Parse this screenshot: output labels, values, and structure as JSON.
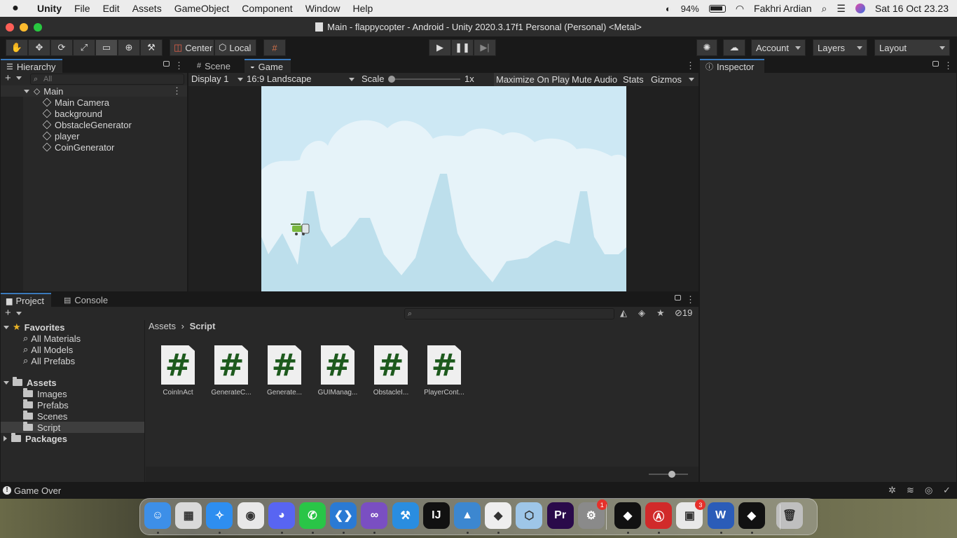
{
  "menubar": {
    "app": "Unity",
    "items": [
      "File",
      "Edit",
      "Assets",
      "GameObject",
      "Component",
      "Window",
      "Help"
    ],
    "battery": "94%",
    "user": "Fakhri Ardian",
    "datetime": "Sat 16 Oct  23.23"
  },
  "window": {
    "title": "Main - flappycopter - Android - Unity 2020.3.17f1 Personal (Personal) <Metal>"
  },
  "toolbar": {
    "pivot": "Center",
    "space": "Local",
    "account": "Account",
    "layers": "Layers",
    "layout": "Layout"
  },
  "hierarchy": {
    "tab": "Hierarchy",
    "search_placeholder": "All",
    "scene": "Main",
    "objects": [
      "Main Camera",
      "background",
      "ObstacleGenerator",
      "player",
      "CoinGenerator"
    ]
  },
  "game_view": {
    "tabs": [
      "Scene",
      "Game"
    ],
    "display": "Display 1",
    "aspect": "16:9 Landscape",
    "scale_label": "Scale",
    "scale_value": "1x",
    "buttons": [
      "Maximize On Play",
      "Mute Audio",
      "Stats",
      "Gizmos"
    ]
  },
  "inspector": {
    "tab": "Inspector"
  },
  "project": {
    "tabs": [
      "Project",
      "Console"
    ],
    "hidden_count": "19",
    "favorites": {
      "label": "Favorites",
      "items": [
        "All Materials",
        "All Models",
        "All Prefabs"
      ]
    },
    "assets": {
      "label": "Assets",
      "folders": [
        "Images",
        "Prefabs",
        "Scenes",
        "Script"
      ]
    },
    "packages": "Packages",
    "breadcrumb": [
      "Assets",
      "Script"
    ],
    "files": [
      "CoinInAct",
      "GenerateC...",
      "Generate...",
      "GUIManag...",
      "ObstacleI...",
      "PlayerCont..."
    ]
  },
  "status": {
    "message": "Game Over"
  },
  "colors": {
    "accent": "#3a79bb",
    "sky": "#cde8f4",
    "cloud": "#e6f3f9",
    "mountain": "#bddfec"
  },
  "dock": {
    "apps": [
      {
        "name": "finder-icon",
        "glyph": "☺",
        "color": "#3d8fe8"
      },
      {
        "name": "launchpad-icon",
        "glyph": "▦",
        "color": "#d9d9d9"
      },
      {
        "name": "safari-icon",
        "glyph": "✧",
        "color": "#2e8ef0"
      },
      {
        "name": "chrome-icon",
        "glyph": "◉",
        "color": "#e8e8e8"
      },
      {
        "name": "discord-icon",
        "glyph": "◕",
        "color": "#5865f2"
      },
      {
        "name": "whatsapp-icon",
        "glyph": "✆",
        "color": "#29c547"
      },
      {
        "name": "vscode-icon",
        "glyph": "❮❯",
        "color": "#2a7ad4"
      },
      {
        "name": "visual-studio-icon",
        "glyph": "∞",
        "color": "#7a4fc2"
      },
      {
        "name": "xcode-icon",
        "glyph": "⚒",
        "color": "#2a8de0"
      },
      {
        "name": "intellij-icon",
        "glyph": "IJ",
        "color": "#111111"
      },
      {
        "name": "android-studio-icon",
        "glyph": "▲",
        "color": "#3c87d0"
      },
      {
        "name": "unity-hub-icon",
        "glyph": "◆",
        "color": "#eeeeee"
      },
      {
        "name": "cube-app-icon",
        "glyph": "⬡",
        "color": "#9ec6e8"
      },
      {
        "name": "premiere-icon",
        "glyph": "Pr",
        "color": "#2a0a4a"
      },
      {
        "name": "system-preferences-icon",
        "glyph": "⚙",
        "color": "#8a8a8a",
        "badge": "1"
      },
      {
        "name": "unity-editor-icon",
        "glyph": "◆",
        "color": "#111111"
      },
      {
        "name": "acrobat-icon",
        "glyph": "Ⓐ",
        "color": "#d12a2a"
      },
      {
        "name": "app-store-icon",
        "glyph": "▣",
        "color": "#e8e8e8",
        "badge": "3"
      },
      {
        "name": "word-icon",
        "glyph": "W",
        "color": "#2b5cb8"
      },
      {
        "name": "unity-player-icon",
        "glyph": "◆",
        "color": "#111111"
      },
      {
        "name": "trash-icon",
        "glyph": "🗑",
        "color": "#bfbfbf"
      }
    ]
  }
}
